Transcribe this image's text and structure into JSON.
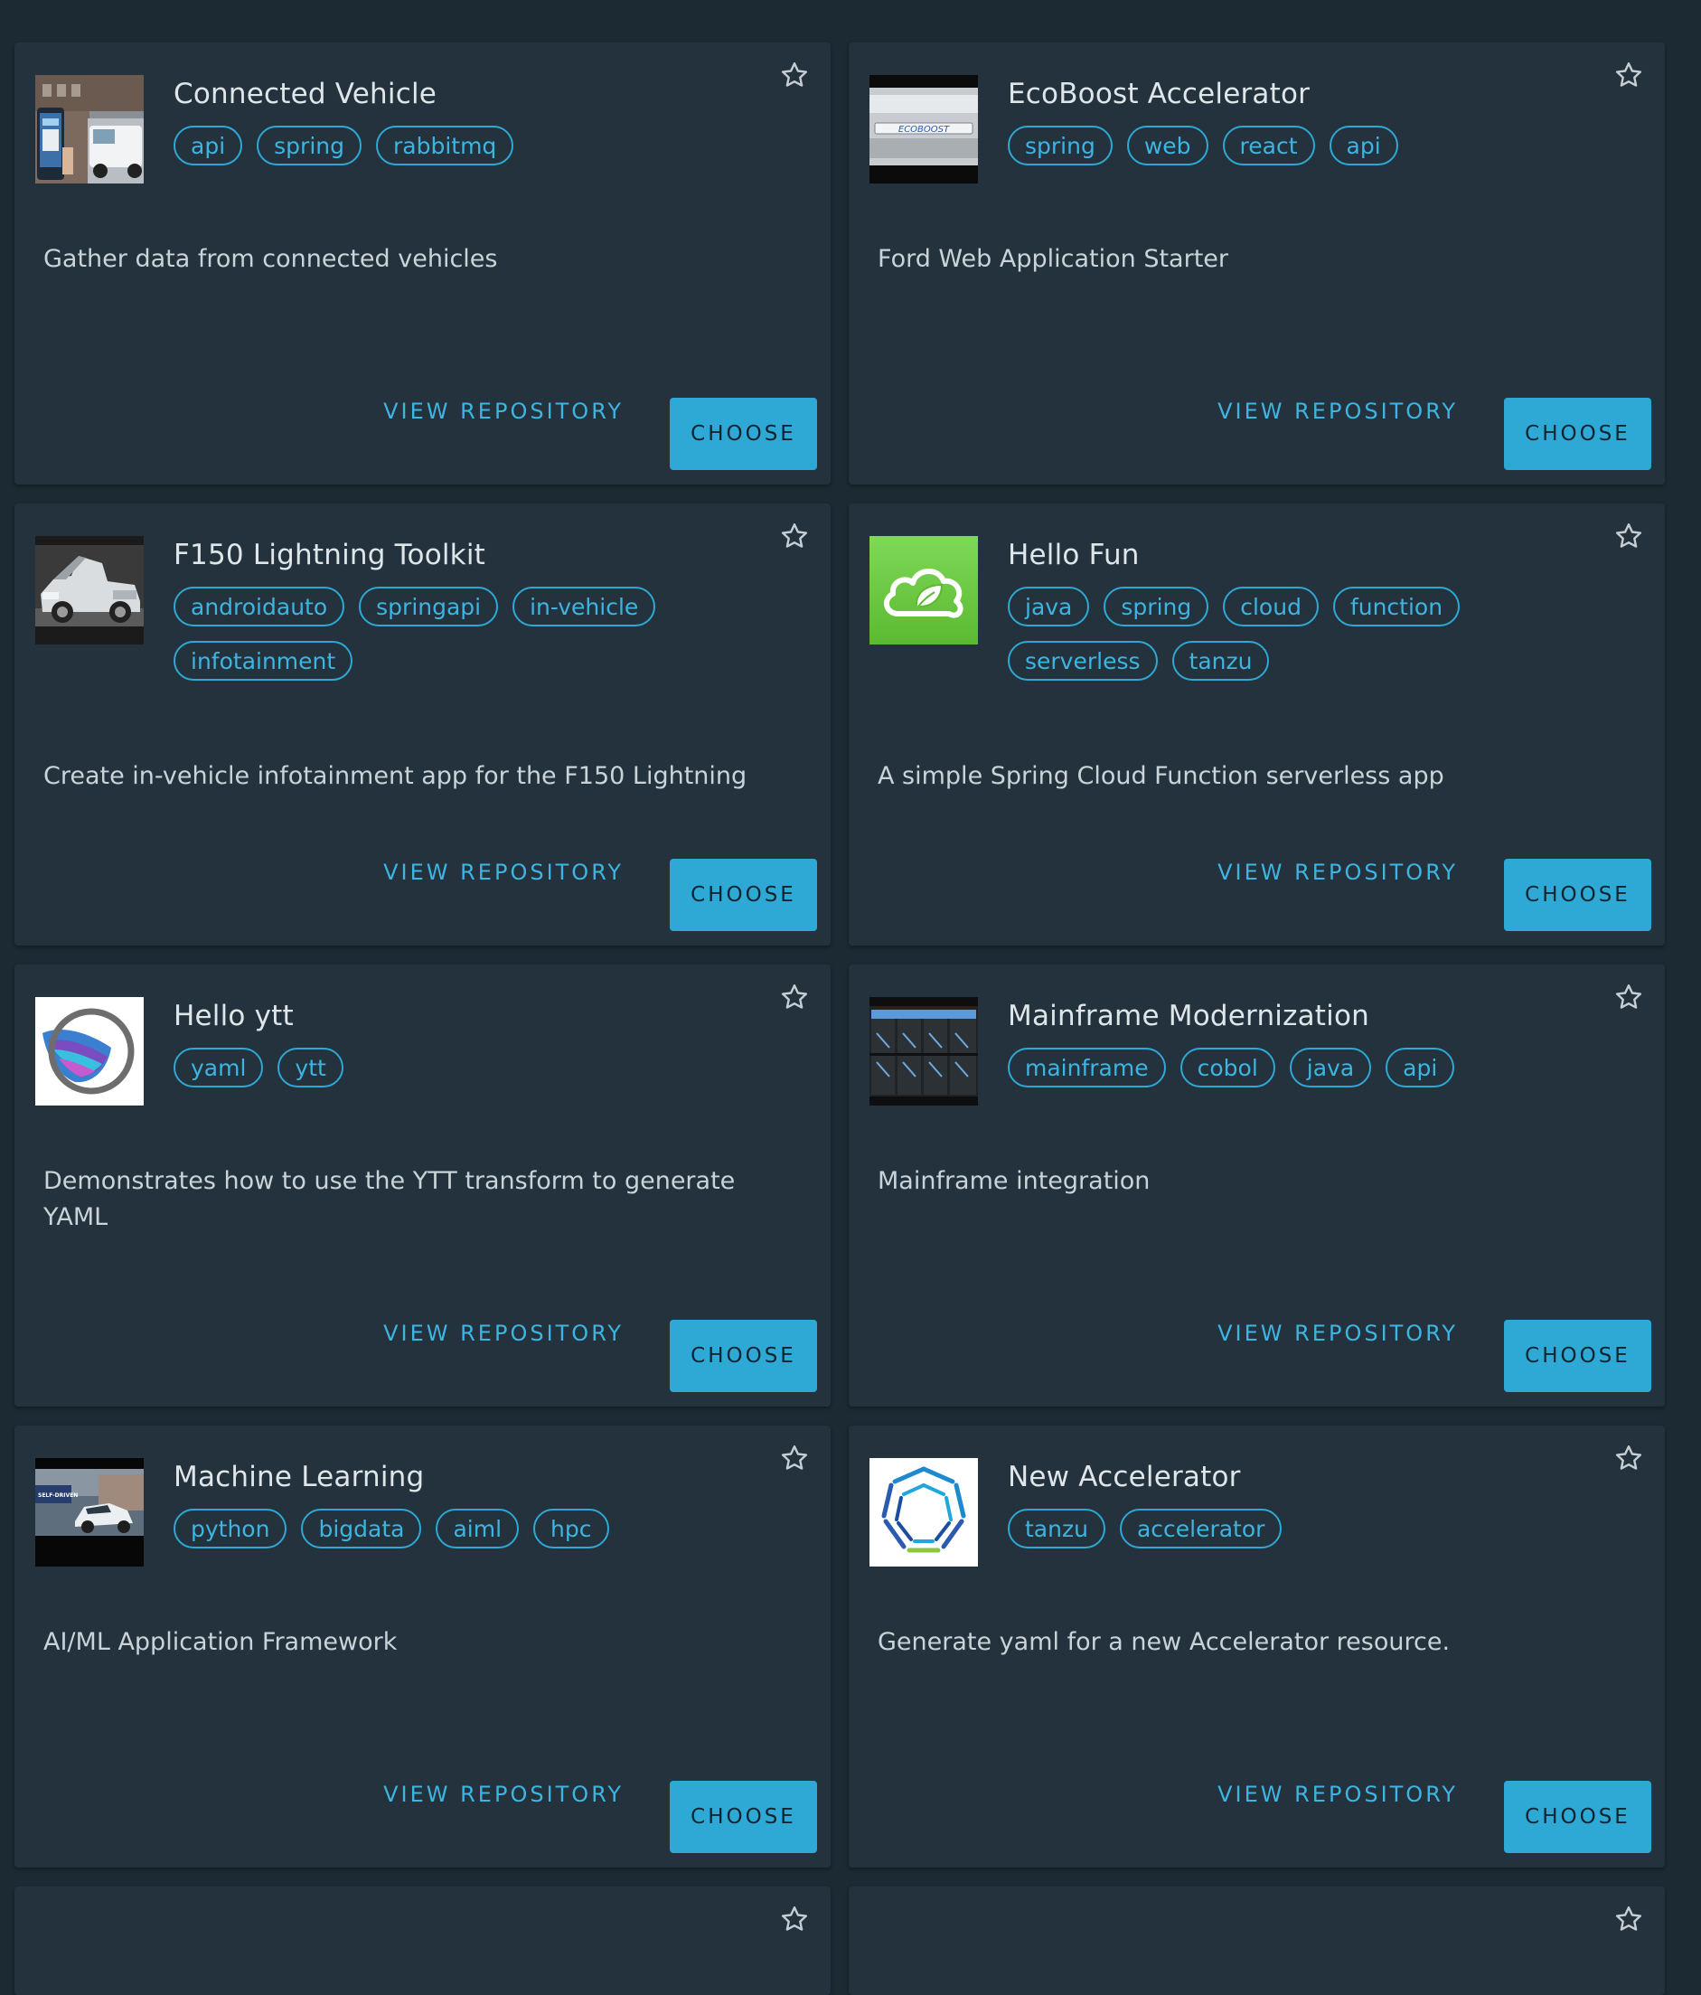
{
  "colors": {
    "background": "#1c2a33",
    "card": "#23323c",
    "accent": "#2ea9d5",
    "title_text": "#dfe6ea",
    "description_text": "#c9d3d8"
  },
  "actions": {
    "view_repository_label": "VIEW REPOSITORY",
    "choose_label": "CHOOSE"
  },
  "cards": [
    {
      "title": "Connected Vehicle",
      "image": "connected-vehicle-photo",
      "tags": [
        "api",
        "spring",
        "rabbitmq"
      ],
      "description": "Gather data from connected vehicles"
    },
    {
      "title": "EcoBoost Accelerator",
      "image": "ecoboost-engine-cover-photo",
      "image_text": "ECOBOOST",
      "tags": [
        "spring",
        "web",
        "react",
        "api"
      ],
      "description": "Ford Web Application Starter"
    },
    {
      "title": "F150 Lightning Toolkit",
      "image": "pickup-truck-photo",
      "tags": [
        "androidauto",
        "springapi",
        "in-vehicle",
        "infotainment"
      ],
      "description": "Create in-vehicle infotainment app for the F150 Lightning"
    },
    {
      "title": "Hello Fun",
      "image": "spring-cloud-leaf-logo",
      "tags": [
        "java",
        "spring",
        "cloud",
        "function",
        "serverless",
        "tanzu"
      ],
      "description": "A simple Spring Cloud Function serverless app"
    },
    {
      "title": "Hello ytt",
      "image": "ytt-logo",
      "tags": [
        "yaml",
        "ytt"
      ],
      "description": "Demonstrates how to use the YTT transform to generate YAML"
    },
    {
      "title": "Mainframe Modernization",
      "image": "mainframe-servers-photo",
      "tags": [
        "mainframe",
        "cobol",
        "java",
        "api"
      ],
      "description": "Mainframe integration"
    },
    {
      "title": "Machine Learning",
      "image": "self-driven-car-photo",
      "image_text": "SELF-DRIVEN",
      "tags": [
        "python",
        "bigdata",
        "aiml",
        "hpc"
      ],
      "description": "AI/ML Application Framework"
    },
    {
      "title": "New Accelerator",
      "image": "tanzu-accelerator-logo",
      "tags": [
        "tanzu",
        "accelerator"
      ],
      "description": "Generate yaml for a new Accelerator resource."
    }
  ]
}
